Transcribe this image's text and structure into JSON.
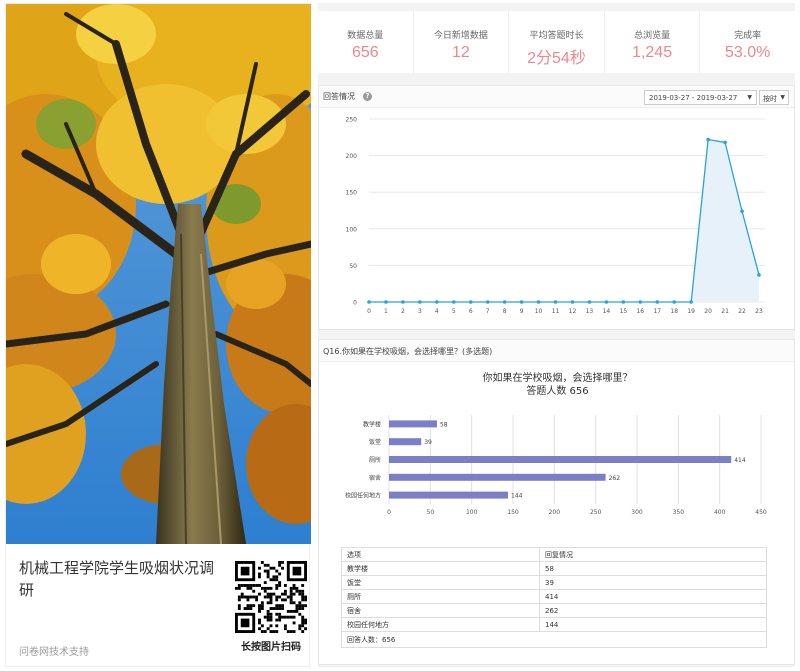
{
  "poster": {
    "title": "机械工程学院学生吸烟状况调研",
    "footer": "问卷网技术支持",
    "qr_caption": "长按图片扫码"
  },
  "stats": [
    {
      "label": "数据总量",
      "value": "656"
    },
    {
      "label": "今日新增数据",
      "value": "12"
    },
    {
      "label": "平均答题时长",
      "value": "2分54秒"
    },
    {
      "label": "总浏览量",
      "value": "1,245"
    },
    {
      "label": "完成率",
      "value": "53.0%"
    }
  ],
  "responses_panel": {
    "title": "回答情况",
    "date_range": "2019-03-27 - 2019-03-27",
    "granularity": "按时"
  },
  "question_panel": {
    "title": "Q16.你如果在学校吸烟，会选择哪里？(多选题)",
    "chart_title": "你如果在学校吸烟，会选择哪里？",
    "chart_subtitle": "答题人数 656"
  },
  "table": {
    "headers": [
      "选项",
      "回复情况"
    ],
    "rows": [
      [
        "教学楼",
        "58"
      ],
      [
        "饭堂",
        "39"
      ],
      [
        "厕所",
        "414"
      ],
      [
        "宿舍",
        "262"
      ],
      [
        "校园任何地方",
        "144"
      ]
    ],
    "total": "回答人数：656"
  },
  "colors": {
    "accent": "#f0868e",
    "line": "#2aa3d9",
    "bar": "#7b7fc7"
  },
  "chart_data": [
    {
      "type": "area",
      "x": [
        "0",
        "1",
        "2",
        "3",
        "4",
        "5",
        "6",
        "7",
        "8",
        "9",
        "10",
        "11",
        "12",
        "13",
        "14",
        "15",
        "16",
        "17",
        "18",
        "19",
        "20",
        "21",
        "22",
        "23"
      ],
      "values": [
        0,
        0,
        0,
        0,
        0,
        0,
        0,
        0,
        0,
        0,
        0,
        0,
        0,
        0,
        0,
        0,
        0,
        0,
        0,
        0,
        222,
        218,
        124,
        37
      ],
      "ylim": [
        0,
        250
      ],
      "yticks": [
        0,
        50,
        100,
        150,
        200,
        250
      ],
      "grid": true
    },
    {
      "type": "bar",
      "orientation": "horizontal",
      "categories": [
        "教学楼",
        "饭堂",
        "厕所",
        "宿舍",
        "校园任何地方"
      ],
      "values": [
        58,
        39,
        414,
        262,
        144
      ],
      "xlim": [
        0,
        450
      ],
      "xticks": [
        0,
        50,
        100,
        150,
        200,
        250,
        300,
        350,
        400,
        450
      ],
      "grid": true
    }
  ]
}
